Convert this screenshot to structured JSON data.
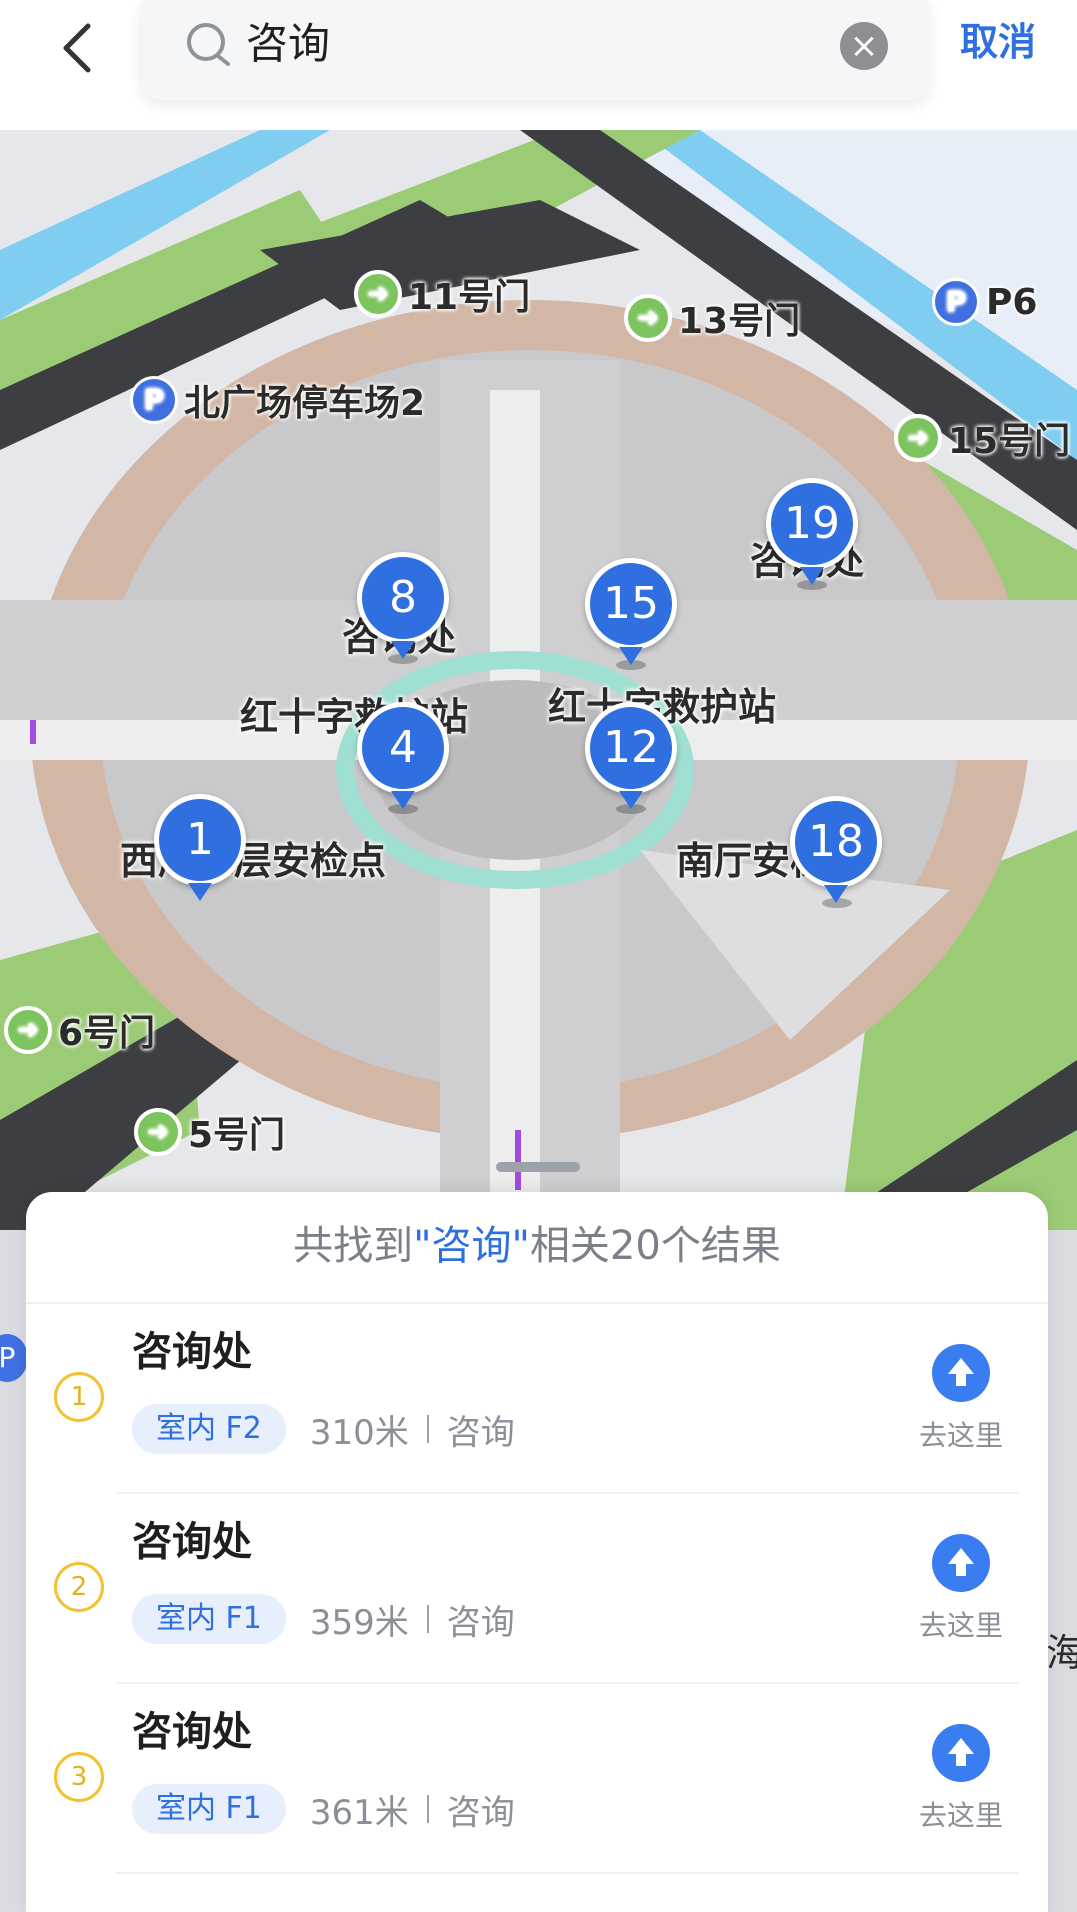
{
  "header": {
    "search_value": "咨询",
    "clear_icon": "close-icon",
    "cancel_label": "取消"
  },
  "map": {
    "doors": [
      {
        "label": "11号门"
      },
      {
        "label": "13号门"
      },
      {
        "label": "15号门"
      },
      {
        "label": "6号门"
      },
      {
        "label": "5号门"
      }
    ],
    "parking": [
      {
        "icon": "P",
        "label": "北广场停车场2"
      },
      {
        "icon": "P",
        "label": "P6"
      }
    ],
    "pins": [
      {
        "num": "19",
        "label": "咨询处"
      },
      {
        "num": "8",
        "label": "咨询处"
      },
      {
        "num": "15",
        "label": "红十字救护站"
      },
      {
        "num": "4",
        "label": "红十字救护站"
      },
      {
        "num": "12",
        "label": "红十字救护站"
      },
      {
        "num": "1",
        "label": "西厅二层安检点"
      },
      {
        "num": "18",
        "label": "南厅安检点"
      }
    ]
  },
  "results": {
    "summary_prefix": "共找到",
    "summary_keyword": "\"咨询\"",
    "summary_suffix": "相关20个结果",
    "items": [
      {
        "rank": "1",
        "title": "咨询处",
        "floor": "室内 F2",
        "distance": "310米",
        "category": "咨询",
        "go_label": "去这里"
      },
      {
        "rank": "2",
        "title": "咨询处",
        "floor": "室内 F1",
        "distance": "359米",
        "category": "咨询",
        "go_label": "去这里"
      },
      {
        "rank": "3",
        "title": "咨询处",
        "floor": "室内 F1",
        "distance": "361米",
        "category": "咨询",
        "go_label": "去这里"
      }
    ]
  },
  "edge": {
    "p_icon": "P",
    "text": "海"
  },
  "colors": {
    "accent": "#2f6fe0",
    "door_green": "#7cc45d",
    "rank_yellow": "#f2c230"
  }
}
